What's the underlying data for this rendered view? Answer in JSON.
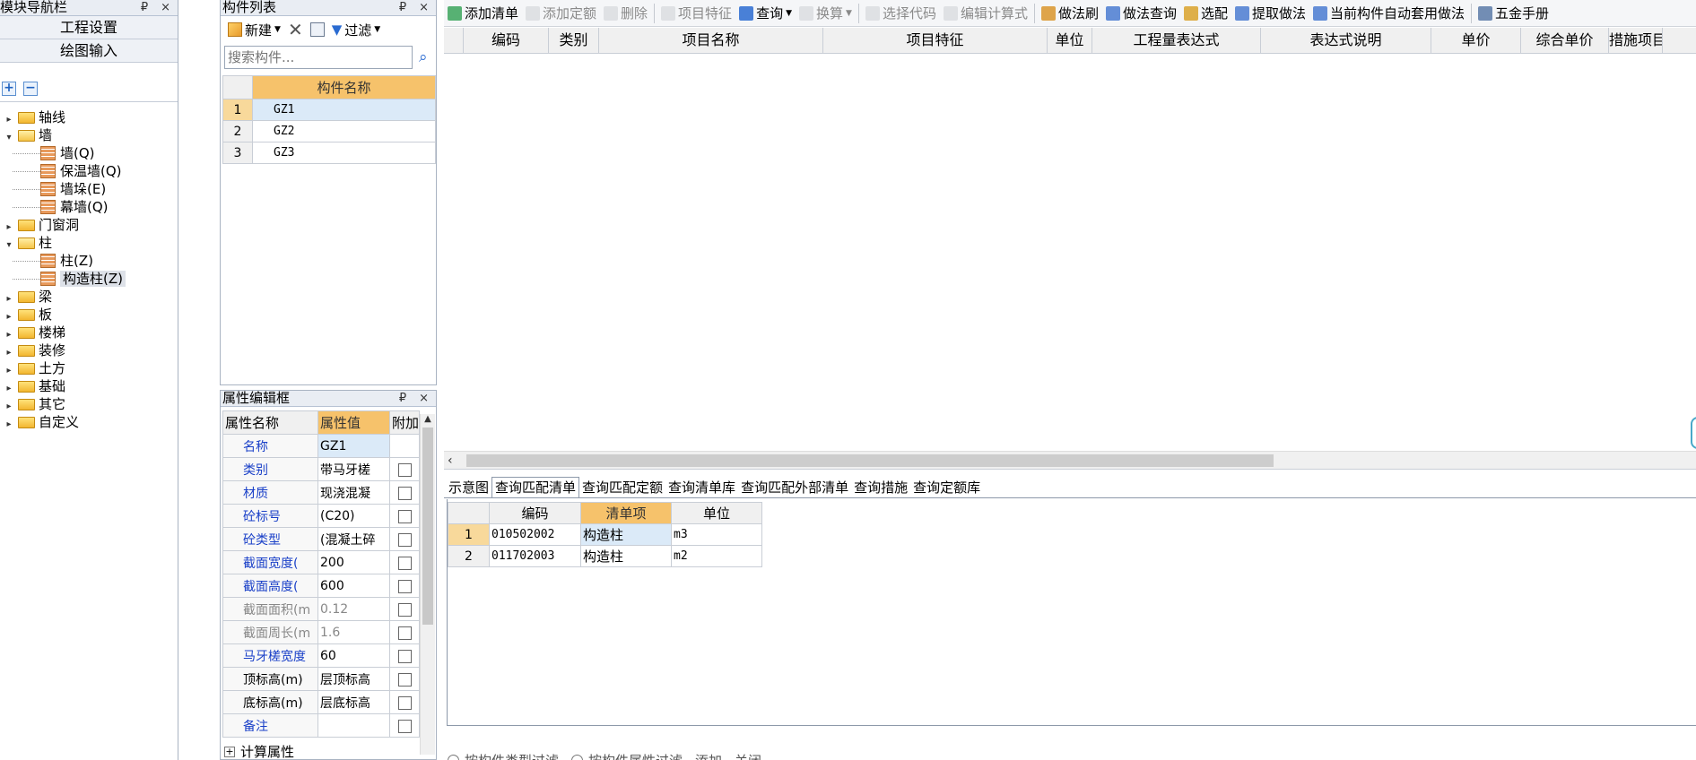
{
  "nav": {
    "title": "模块导航栏",
    "pin": "₽",
    "close": "×",
    "project_settings": "工程设置",
    "drawing_input": "绘图输入",
    "expand_all": "+",
    "collapse_all": "−",
    "tree": [
      {
        "label": "轴线",
        "level": 0,
        "state": "closed"
      },
      {
        "label": "墙",
        "level": 0,
        "state": "open"
      },
      {
        "label": "墙(Q)",
        "level": 1,
        "state": "leaf"
      },
      {
        "label": "保温墙(Q)",
        "level": 1,
        "state": "leaf"
      },
      {
        "label": "墙垛(E)",
        "level": 1,
        "state": "leaf"
      },
      {
        "label": "幕墙(Q)",
        "level": 1,
        "state": "leaf"
      },
      {
        "label": "门窗洞",
        "level": 0,
        "state": "closed"
      },
      {
        "label": "柱",
        "level": 0,
        "state": "open"
      },
      {
        "label": "柱(Z)",
        "level": 1,
        "state": "leaf"
      },
      {
        "label": "构造柱(Z)",
        "level": 1,
        "state": "leaf",
        "selected": true
      },
      {
        "label": "梁",
        "level": 0,
        "state": "closed"
      },
      {
        "label": "板",
        "level": 0,
        "state": "closed"
      },
      {
        "label": "楼梯",
        "level": 0,
        "state": "closed"
      },
      {
        "label": "装修",
        "level": 0,
        "state": "closed"
      },
      {
        "label": "土方",
        "level": 0,
        "state": "closed"
      },
      {
        "label": "基础",
        "level": 0,
        "state": "closed"
      },
      {
        "label": "其它",
        "level": 0,
        "state": "closed"
      },
      {
        "label": "自定义",
        "level": 0,
        "state": "closed"
      }
    ]
  },
  "component_list": {
    "title": "构件列表",
    "new_label": "新建",
    "filter_label": "过滤",
    "search_placeholder": "搜索构件...",
    "header": "构件名称",
    "rows": [
      {
        "num": "1",
        "name": "GZ1"
      },
      {
        "num": "2",
        "name": "GZ2"
      },
      {
        "num": "3",
        "name": "GZ3"
      }
    ]
  },
  "props": {
    "title": "属性编辑框",
    "col_name": "属性名称",
    "col_value": "属性值",
    "col_extra": "附加",
    "rows": [
      {
        "name": "名称",
        "value": "GZ1",
        "style": "blue",
        "check": false
      },
      {
        "name": "类别",
        "value": "带马牙槎",
        "style": "blue",
        "check": true
      },
      {
        "name": "材质",
        "value": "现浇混凝",
        "style": "blue",
        "check": true
      },
      {
        "name": "砼标号",
        "value": "(C20)",
        "style": "blue",
        "check": true
      },
      {
        "name": "砼类型",
        "value": "(混凝土碎",
        "style": "blue",
        "check": true
      },
      {
        "name": "截面宽度(",
        "value": "200",
        "style": "blue",
        "check": true
      },
      {
        "name": "截面高度(",
        "value": "600",
        "style": "blue",
        "check": true
      },
      {
        "name": "截面面积(m",
        "value": "0.12",
        "style": "gray",
        "check": true
      },
      {
        "name": "截面周长(m",
        "value": "1.6",
        "style": "gray",
        "check": true
      },
      {
        "name": "马牙槎宽度",
        "value": "60",
        "style": "blue",
        "check": true
      },
      {
        "name": "顶标高(m)",
        "value": "层顶标高",
        "style": "black",
        "check": true
      },
      {
        "name": "底标高(m)",
        "value": "层底标高",
        "style": "black",
        "check": true
      },
      {
        "name": "备注",
        "value": "",
        "style": "blue",
        "check": true
      }
    ],
    "calc_props": "计算属性"
  },
  "toolbar": {
    "items": [
      {
        "label": "添加清单",
        "icon": "add-list-icon",
        "enabled": true,
        "dropdown": false
      },
      {
        "label": "添加定额",
        "icon": "add-quota-icon",
        "enabled": false,
        "dropdown": false
      },
      {
        "label": "删除",
        "icon": "delete-icon",
        "enabled": false,
        "dropdown": false
      },
      {
        "label": "项目特征",
        "icon": "feature-icon",
        "enabled": false,
        "dropdown": false
      },
      {
        "label": "查询",
        "icon": "search-icon",
        "enabled": true,
        "dropdown": true
      },
      {
        "label": "换算",
        "icon": "convert-icon",
        "enabled": false,
        "dropdown": true
      },
      {
        "label": "选择代码",
        "icon": "select-code-icon",
        "enabled": false,
        "dropdown": false
      },
      {
        "label": "编辑计算式",
        "icon": "edit-formula-icon",
        "enabled": false,
        "dropdown": false
      },
      {
        "label": "做法刷",
        "icon": "brush-icon",
        "enabled": true,
        "dropdown": false
      },
      {
        "label": "做法查询",
        "icon": "method-query-icon",
        "enabled": true,
        "dropdown": false
      },
      {
        "label": "选配",
        "icon": "match-icon",
        "enabled": true,
        "dropdown": false
      },
      {
        "label": "提取做法",
        "icon": "extract-icon",
        "enabled": true,
        "dropdown": false
      },
      {
        "label": "当前构件自动套用做法",
        "icon": "auto-apply-icon",
        "enabled": true,
        "dropdown": false
      },
      {
        "label": "五金手册",
        "icon": "handbook-icon",
        "enabled": true,
        "dropdown": false
      }
    ]
  },
  "main_table": {
    "columns": [
      "编码",
      "类别",
      "项目名称",
      "项目特征",
      "单位",
      "工程量表达式",
      "表达式说明",
      "单价",
      "综合单价",
      "措施项目"
    ]
  },
  "bottom": {
    "tabs": [
      "示意图",
      "查询匹配清单",
      "查询匹配定额",
      "查询清单库",
      "查询匹配外部清单",
      "查询措施",
      "查询定额库"
    ],
    "active_tab": 1,
    "columns": [
      "编码",
      "清单项",
      "单位"
    ],
    "rows": [
      {
        "num": "1",
        "code": "010502002",
        "item": "构造柱",
        "unit": "m3"
      },
      {
        "num": "2",
        "code": "011702003",
        "item": "构造柱",
        "unit": "m2"
      }
    ],
    "footer_options": [
      "按构件类型过滤",
      "按构件属性过滤",
      "添加",
      "关闭"
    ]
  },
  "colors": {
    "panel_title": "#e9edf3",
    "header_orange": "#f6c26b",
    "selection": "#dbeaf8",
    "link_blue": "#1a40c8"
  }
}
